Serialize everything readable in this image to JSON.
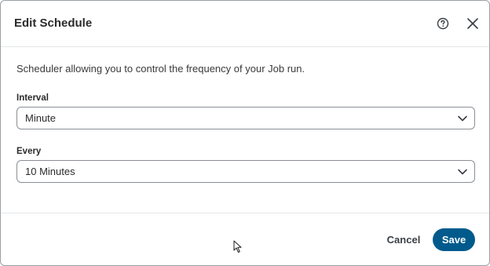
{
  "dialog": {
    "title": "Edit Schedule",
    "help_icon": "help-circle-icon",
    "close_icon": "close-icon"
  },
  "content": {
    "description": "Scheduler allowing you to control the frequency of your Job run.",
    "interval": {
      "label": "Interval",
      "value": "Minute"
    },
    "every": {
      "label": "Every",
      "value": "10 Minutes"
    }
  },
  "footer": {
    "cancel_label": "Cancel",
    "save_label": "Save"
  },
  "colors": {
    "primary": "#005a8c",
    "border": "#8a8f96",
    "divider": "#e3e5e8",
    "text": "#2b2b2b"
  }
}
